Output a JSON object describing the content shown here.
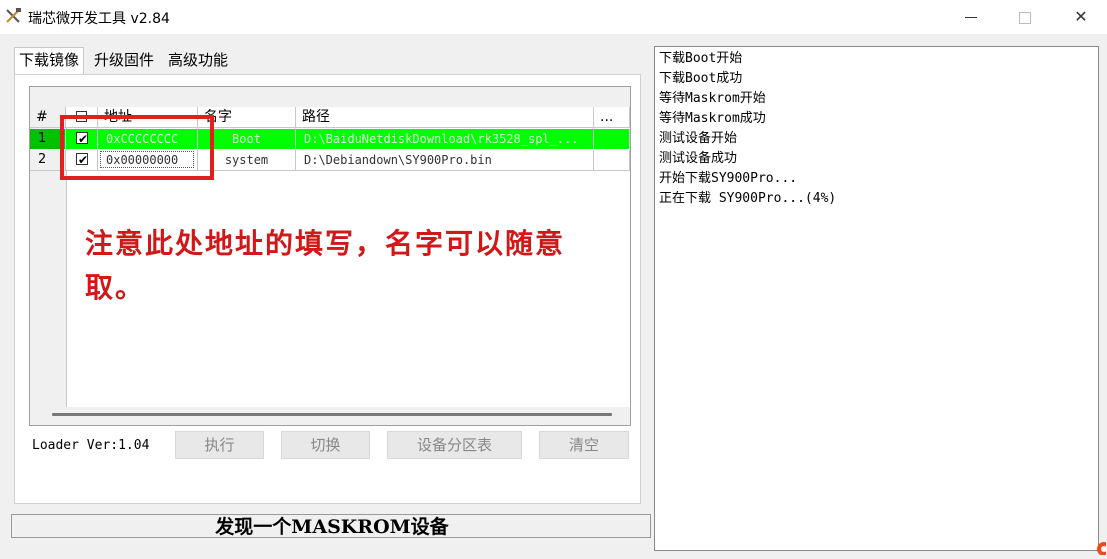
{
  "window": {
    "title": "瑞芯微开发工具 v2.84",
    "icons": {
      "app": "tools-icon",
      "minimize": "minimize-icon",
      "maximize": "maximize-icon",
      "close": "close-icon"
    },
    "close_glyph": "✕"
  },
  "tabs": [
    {
      "label": "下载镜像",
      "active": true
    },
    {
      "label": "升级固件",
      "active": false
    },
    {
      "label": "高级功能",
      "active": false
    }
  ],
  "table": {
    "columns": [
      "#",
      "地址",
      "名字",
      "路径",
      "..."
    ],
    "rows": [
      {
        "index": "1",
        "checked": true,
        "address": "0xCCCCCCCC",
        "name": "Boot",
        "path": "D:\\BaiduNetdiskDownload\\rk3528_spl_..."
      },
      {
        "index": "2",
        "checked": true,
        "address": "0x00000000",
        "name": "system",
        "path": "D:\\Debiandown\\SY900Pro.bin"
      }
    ],
    "check_glyph": "✔",
    "highlight_color": "#00ff00"
  },
  "annotation": {
    "text": "注意此处地址的填写，名字可以随意取。",
    "color": "#d01818"
  },
  "loader_ver": "Loader Ver:1.04",
  "buttons": {
    "execute": "执行",
    "switch": "切换",
    "partition_table": "设备分区表",
    "clear": "清空"
  },
  "status": "发现一个MASKROM设备",
  "log": [
    "下载Boot开始",
    "下载Boot成功",
    "等待Maskrom开始",
    "等待Maskrom成功",
    "测试设备开始",
    "测试设备成功",
    "开始下载SY900Pro...",
    "正在下载 SY900Pro...(4%)"
  ]
}
